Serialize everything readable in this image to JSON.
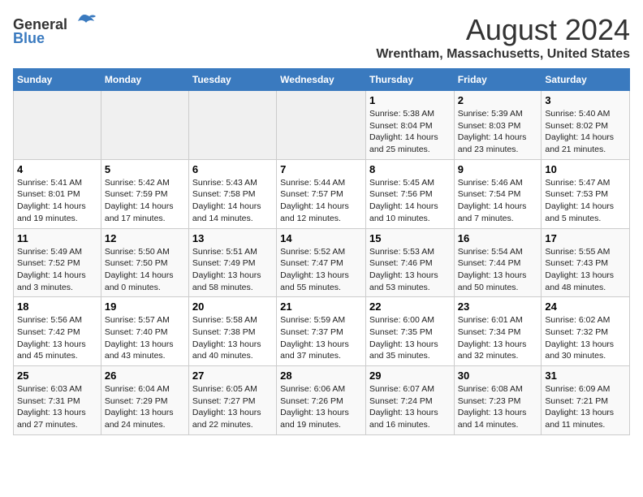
{
  "logo": {
    "general": "General",
    "blue": "Blue"
  },
  "title": "August 2024",
  "location": "Wrentham, Massachusetts, United States",
  "weekdays": [
    "Sunday",
    "Monday",
    "Tuesday",
    "Wednesday",
    "Thursday",
    "Friday",
    "Saturday"
  ],
  "weeks": [
    [
      {
        "day": "",
        "empty": true
      },
      {
        "day": "",
        "empty": true
      },
      {
        "day": "",
        "empty": true
      },
      {
        "day": "",
        "empty": true
      },
      {
        "day": "1",
        "sunrise": "5:38 AM",
        "sunset": "8:04 PM",
        "daylight": "14 hours and 25 minutes."
      },
      {
        "day": "2",
        "sunrise": "5:39 AM",
        "sunset": "8:03 PM",
        "daylight": "14 hours and 23 minutes."
      },
      {
        "day": "3",
        "sunrise": "5:40 AM",
        "sunset": "8:02 PM",
        "daylight": "14 hours and 21 minutes."
      }
    ],
    [
      {
        "day": "4",
        "sunrise": "5:41 AM",
        "sunset": "8:01 PM",
        "daylight": "14 hours and 19 minutes."
      },
      {
        "day": "5",
        "sunrise": "5:42 AM",
        "sunset": "7:59 PM",
        "daylight": "14 hours and 17 minutes."
      },
      {
        "day": "6",
        "sunrise": "5:43 AM",
        "sunset": "7:58 PM",
        "daylight": "14 hours and 14 minutes."
      },
      {
        "day": "7",
        "sunrise": "5:44 AM",
        "sunset": "7:57 PM",
        "daylight": "14 hours and 12 minutes."
      },
      {
        "day": "8",
        "sunrise": "5:45 AM",
        "sunset": "7:56 PM",
        "daylight": "14 hours and 10 minutes."
      },
      {
        "day": "9",
        "sunrise": "5:46 AM",
        "sunset": "7:54 PM",
        "daylight": "14 hours and 7 minutes."
      },
      {
        "day": "10",
        "sunrise": "5:47 AM",
        "sunset": "7:53 PM",
        "daylight": "14 hours and 5 minutes."
      }
    ],
    [
      {
        "day": "11",
        "sunrise": "5:49 AM",
        "sunset": "7:52 PM",
        "daylight": "14 hours and 3 minutes."
      },
      {
        "day": "12",
        "sunrise": "5:50 AM",
        "sunset": "7:50 PM",
        "daylight": "14 hours and 0 minutes."
      },
      {
        "day": "13",
        "sunrise": "5:51 AM",
        "sunset": "7:49 PM",
        "daylight": "13 hours and 58 minutes."
      },
      {
        "day": "14",
        "sunrise": "5:52 AM",
        "sunset": "7:47 PM",
        "daylight": "13 hours and 55 minutes."
      },
      {
        "day": "15",
        "sunrise": "5:53 AM",
        "sunset": "7:46 PM",
        "daylight": "13 hours and 53 minutes."
      },
      {
        "day": "16",
        "sunrise": "5:54 AM",
        "sunset": "7:44 PM",
        "daylight": "13 hours and 50 minutes."
      },
      {
        "day": "17",
        "sunrise": "5:55 AM",
        "sunset": "7:43 PM",
        "daylight": "13 hours and 48 minutes."
      }
    ],
    [
      {
        "day": "18",
        "sunrise": "5:56 AM",
        "sunset": "7:42 PM",
        "daylight": "13 hours and 45 minutes."
      },
      {
        "day": "19",
        "sunrise": "5:57 AM",
        "sunset": "7:40 PM",
        "daylight": "13 hours and 43 minutes."
      },
      {
        "day": "20",
        "sunrise": "5:58 AM",
        "sunset": "7:38 PM",
        "daylight": "13 hours and 40 minutes."
      },
      {
        "day": "21",
        "sunrise": "5:59 AM",
        "sunset": "7:37 PM",
        "daylight": "13 hours and 37 minutes."
      },
      {
        "day": "22",
        "sunrise": "6:00 AM",
        "sunset": "7:35 PM",
        "daylight": "13 hours and 35 minutes."
      },
      {
        "day": "23",
        "sunrise": "6:01 AM",
        "sunset": "7:34 PM",
        "daylight": "13 hours and 32 minutes."
      },
      {
        "day": "24",
        "sunrise": "6:02 AM",
        "sunset": "7:32 PM",
        "daylight": "13 hours and 30 minutes."
      }
    ],
    [
      {
        "day": "25",
        "sunrise": "6:03 AM",
        "sunset": "7:31 PM",
        "daylight": "13 hours and 27 minutes."
      },
      {
        "day": "26",
        "sunrise": "6:04 AM",
        "sunset": "7:29 PM",
        "daylight": "13 hours and 24 minutes."
      },
      {
        "day": "27",
        "sunrise": "6:05 AM",
        "sunset": "7:27 PM",
        "daylight": "13 hours and 22 minutes."
      },
      {
        "day": "28",
        "sunrise": "6:06 AM",
        "sunset": "7:26 PM",
        "daylight": "13 hours and 19 minutes."
      },
      {
        "day": "29",
        "sunrise": "6:07 AM",
        "sunset": "7:24 PM",
        "daylight": "13 hours and 16 minutes."
      },
      {
        "day": "30",
        "sunrise": "6:08 AM",
        "sunset": "7:23 PM",
        "daylight": "13 hours and 14 minutes."
      },
      {
        "day": "31",
        "sunrise": "6:09 AM",
        "sunset": "7:21 PM",
        "daylight": "13 hours and 11 minutes."
      }
    ]
  ]
}
